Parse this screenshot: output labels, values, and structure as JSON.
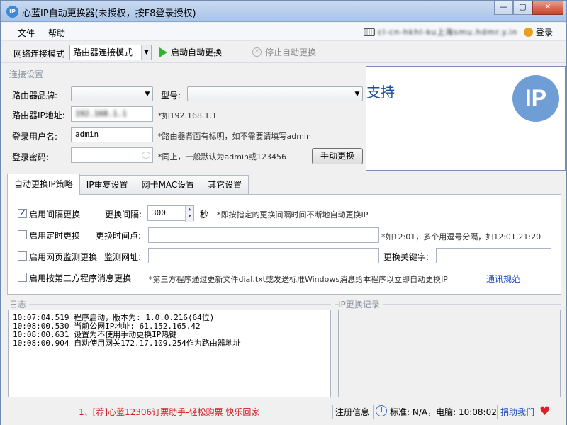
{
  "window": {
    "title": "心蓝IP自动更换器(未授权，按F8登录授权)",
    "app_icon": "IP",
    "minimize": "—",
    "maximize": "▢",
    "close": "✕"
  },
  "menu": {
    "items": [
      "文件",
      "帮助"
    ],
    "machine_info": "cl-cn-hkhl-ku上海smu.hdmr.y.in",
    "login_label": "登录"
  },
  "toolbar": {
    "mode_label": "网络连接模式",
    "mode_value": "路由器连接模式",
    "start_label": "启动自动更换",
    "stop_label": "停止自动更换"
  },
  "connection": {
    "group_title": "连接设置",
    "brand_label": "路由器品牌:",
    "brand_value": "",
    "model_label": "型号:",
    "model_value": "",
    "ip_label": "路由器IP地址:",
    "ip_value": "192.168.1.1",
    "ip_hint": "*如192.168.1.1",
    "user_label": "登录用户名:",
    "user_value": "admin",
    "user_hint": "*路由器背面有标明，如不需要请填写admin",
    "pass_label": "登录密码:",
    "pass_value": "",
    "pass_hint": "*同上，一般默认为admin或123456",
    "manual_button": "手动更换"
  },
  "ad": {
    "text": "支持",
    "logo_text": "IP"
  },
  "tabs": [
    {
      "label": "自动更换IP策略"
    },
    {
      "label": "IP重复设置"
    },
    {
      "label": "网卡MAC设置"
    },
    {
      "label": "其它设置"
    }
  ],
  "strategy": {
    "interval": {
      "checked": true,
      "label": "启用间隔更换",
      "field_label": "更换间隔:",
      "value": "300",
      "unit": "秒",
      "hint": "*即按指定的更换间隔时间不断地自动更换IP"
    },
    "timed": {
      "checked": false,
      "label": "启用定时更换",
      "field_label": "更换时间点:",
      "value": "",
      "hint": "*如12:01，多个用逗号分隔，如12:01,21:20"
    },
    "web_monitor": {
      "checked": false,
      "label": "启用网页监测更换",
      "url_label": "监测网址:",
      "url_value": "",
      "keyword_label": "更换关键字:",
      "keyword_value": ""
    },
    "third_party": {
      "checked": false,
      "label": "启用按第三方程序消息更换",
      "hint": "*第三方程序通过更新文件dial.txt或发送标准Windows消息给本程序以立即自动更换IP",
      "link": "通讯规范"
    }
  },
  "log": {
    "title": "日志",
    "lines": [
      "10:07:04.519 程序启动，版本为: 1.0.0.216(64位)",
      "10:08:00.530 当前公网IP地址: 61.152.165.42",
      "10:08:00.631 设置为不使用手动更换IP热键",
      "10:08:00.904 自动使用网关172.17.109.254作为路由器地址"
    ]
  },
  "records": {
    "title": "IP更换记录"
  },
  "status": {
    "promo": "1、[荐]心蓝12306订票助手-轻松购票 快乐回家",
    "register": "注册信息",
    "time_text": "标准: N/A，电脑: 10:08:02",
    "donate": "捐助我们"
  }
}
